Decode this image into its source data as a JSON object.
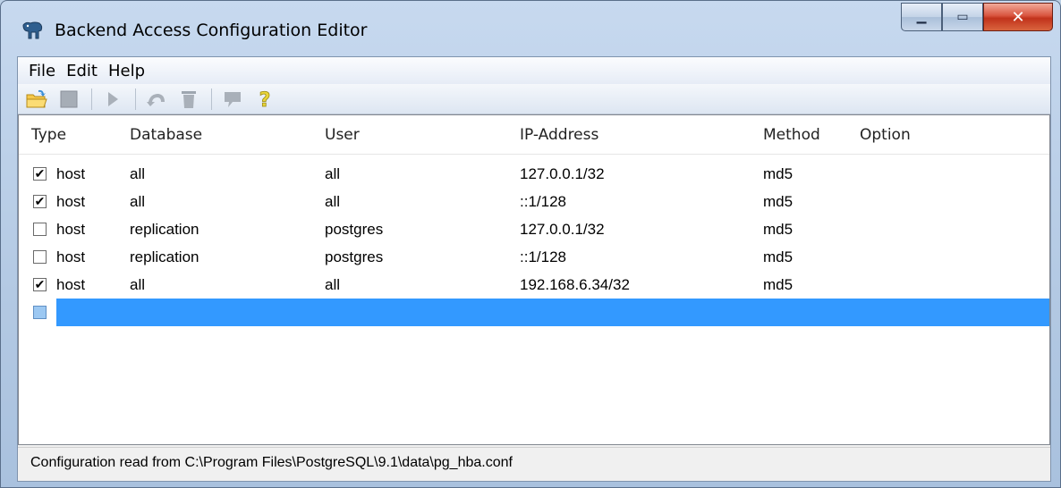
{
  "window": {
    "title": "Backend Access Configuration Editor",
    "icon": "postgres-elephant-icon"
  },
  "menu": [
    "File",
    "Edit",
    "Help"
  ],
  "toolbar": {
    "icons": [
      "open-folder-icon",
      "save-icon",
      "execute-icon",
      "undo-icon",
      "delete-icon",
      "hint-icon",
      "help-icon"
    ]
  },
  "table": {
    "columns": [
      "Type",
      "Database",
      "User",
      "IP-Address",
      "Method",
      "Option"
    ],
    "rows": [
      {
        "checked": true,
        "type": "host",
        "database": "all",
        "user": "all",
        "ip": "127.0.0.1/32",
        "method": "md5",
        "option": ""
      },
      {
        "checked": true,
        "type": "host",
        "database": "all",
        "user": "all",
        "ip": "::1/128",
        "method": "md5",
        "option": ""
      },
      {
        "checked": false,
        "type": "host",
        "database": "replication",
        "user": "postgres",
        "ip": "127.0.0.1/32",
        "method": "md5",
        "option": ""
      },
      {
        "checked": false,
        "type": "host",
        "database": "replication",
        "user": "postgres",
        "ip": "::1/128",
        "method": "md5",
        "option": ""
      },
      {
        "checked": true,
        "type": "host",
        "database": "all",
        "user": "all",
        "ip": "192.168.6.34/32",
        "method": "md5",
        "option": ""
      }
    ],
    "selected_empty_row": true
  },
  "status": {
    "text": "Configuration read from C:\\Program Files\\PostgreSQL\\9.1\\data\\pg_hba.conf"
  },
  "colors": {
    "selection": "#3399ff",
    "close_button": "#c1321b"
  }
}
